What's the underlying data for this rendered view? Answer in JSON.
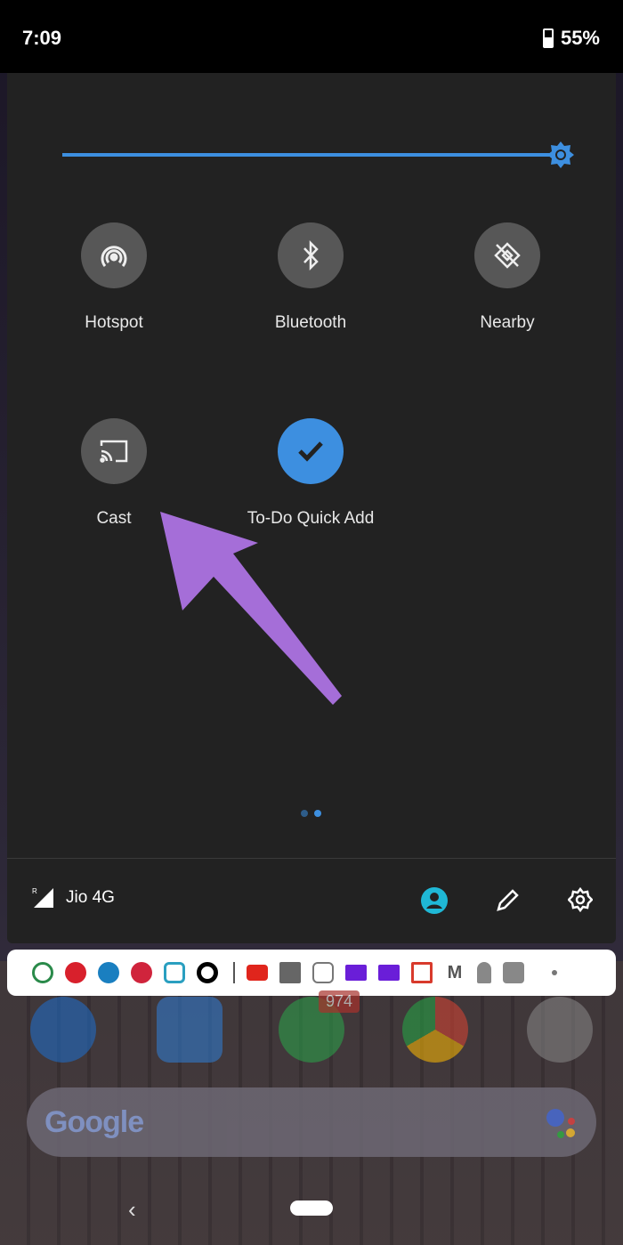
{
  "status_bar": {
    "time": "7:09",
    "battery": "55%"
  },
  "brightness": {
    "level": 1.0,
    "accent": "#3d8fe0"
  },
  "tiles": [
    {
      "label": "Hotspot",
      "icon": "hotspot-icon",
      "active": false
    },
    {
      "label": "Bluetooth",
      "icon": "bluetooth-icon",
      "active": false
    },
    {
      "label": "Nearby",
      "icon": "nearby-icon",
      "active": false
    },
    {
      "label": "Cast",
      "icon": "cast-icon",
      "active": false
    },
    {
      "label": "To-Do Quick Add",
      "icon": "check-icon",
      "active": true
    }
  ],
  "page_indicator": {
    "pages": 2,
    "current": 2
  },
  "footer": {
    "network": "Jio 4G",
    "roaming": "R"
  },
  "notification_icons": [
    "whatsapp",
    "app-red",
    "telegram",
    "pinterest",
    "instagram",
    "circle-app",
    "j-app",
    "youtube",
    "facebook",
    "instagram-outline",
    "mail-purple",
    "mail-purple",
    "gmail",
    "m-app",
    "bell",
    "gray-square",
    "dot"
  ],
  "dock": {
    "whatsapp_badge": "974"
  },
  "search": {
    "logo": "Google"
  },
  "annotation": {
    "arrow_color": "#a56ed8"
  }
}
